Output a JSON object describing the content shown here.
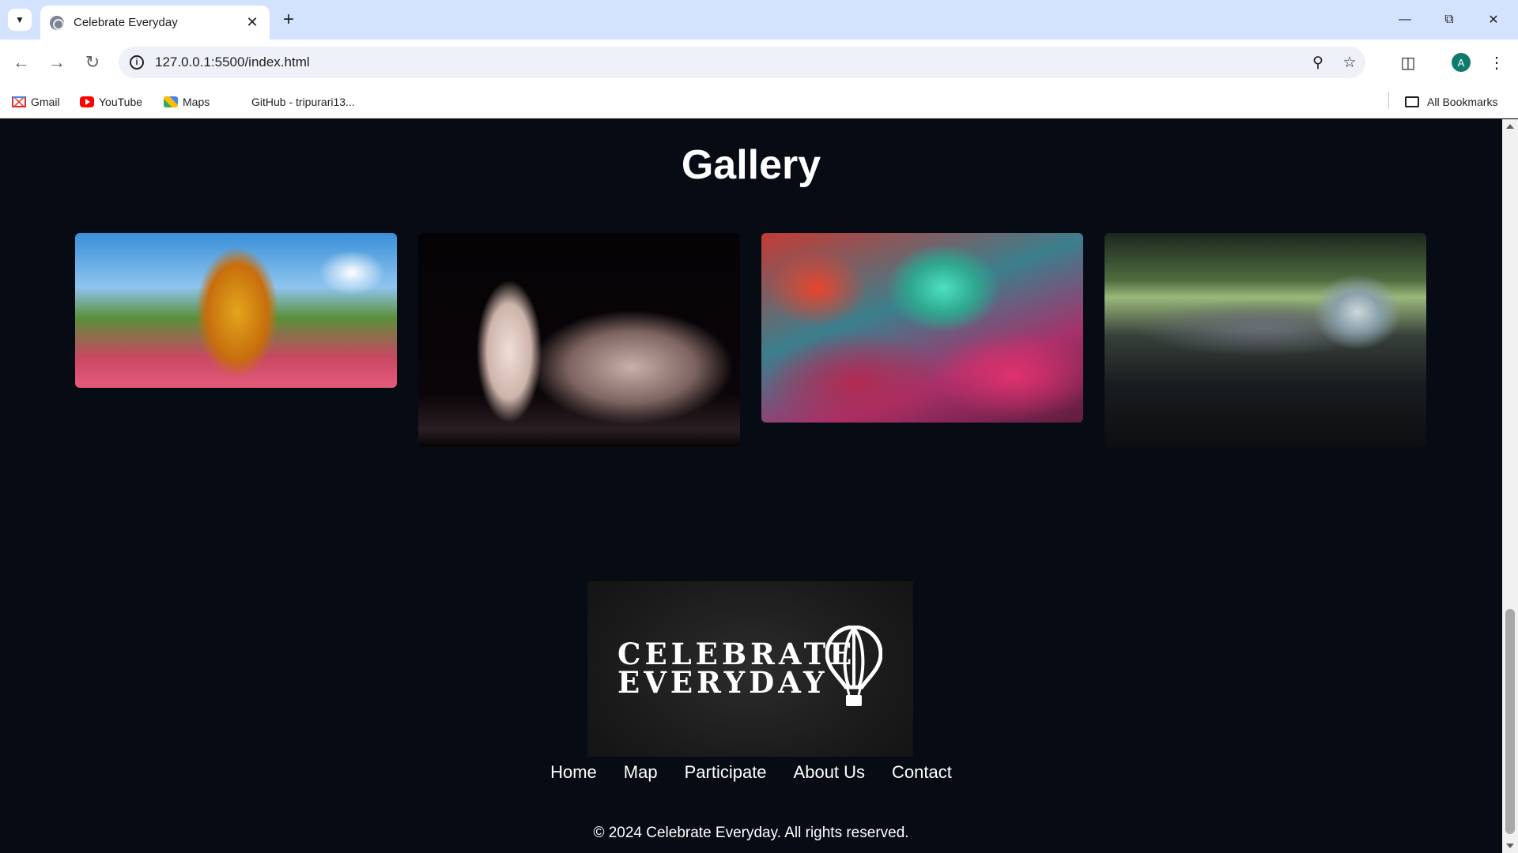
{
  "browser": {
    "tab_title": "Celebrate Everyday",
    "url": "127.0.0.1:5500/index.html",
    "avatar_letter": "A",
    "bookmarks": [
      {
        "label": "Gmail",
        "icon": "gmail-icon"
      },
      {
        "label": "YouTube",
        "icon": "youtube-icon"
      },
      {
        "label": "Maps",
        "icon": "maps-icon"
      },
      {
        "label": "GitHub - tripurari13...",
        "icon": "github-icon"
      }
    ],
    "all_bookmarks_label": "All Bookmarks"
  },
  "page": {
    "gallery_title": "Gallery",
    "gallery_images": [
      {
        "subject": "Kathakali dancer at a street festival with crowd"
      },
      {
        "subject": "Ballet dancers in white dresses on a dark stage"
      },
      {
        "subject": "Holi festival crowd covered in colored powder"
      },
      {
        "subject": "Outdoor music festival crowd with DJ booth"
      }
    ],
    "logo": {
      "line1": "CELEBRATE",
      "line2": "EVERYDAY",
      "icon": "hot-air-balloon-icon"
    },
    "footer_nav": [
      "Home",
      "Map",
      "Participate",
      "About Us",
      "Contact"
    ],
    "copyright": "© 2024 Celebrate Everyday. All rights reserved."
  },
  "colors": {
    "page_background": "#060b14",
    "tabbar_background": "#d3e3fd",
    "text_primary": "#ffffff"
  }
}
